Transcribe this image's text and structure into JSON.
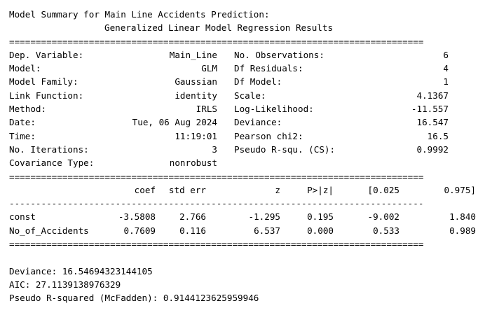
{
  "header": {
    "line1": "Model Summary for Main Line Accidents Prediction:",
    "line2": "Generalized Linear Model Regression Results"
  },
  "rules": {
    "double": "==============================================================================",
    "single": "------------------------------------------------------------------------------"
  },
  "info": [
    {
      "l_label": "Dep. Variable:",
      "l_value": "Main_Line",
      "r_label": "No. Observations:",
      "r_value": "6"
    },
    {
      "l_label": "Model:",
      "l_value": "GLM",
      "r_label": "Df Residuals:",
      "r_value": "4"
    },
    {
      "l_label": "Model Family:",
      "l_value": "Gaussian",
      "r_label": "Df Model:",
      "r_value": "1"
    },
    {
      "l_label": "Link Function:",
      "l_value": "identity",
      "r_label": "Scale:",
      "r_value": "4.1367"
    },
    {
      "l_label": "Method:",
      "l_value": "IRLS",
      "r_label": "Log-Likelihood:",
      "r_value": "-11.557"
    },
    {
      "l_label": "Date:",
      "l_value": "Tue, 06 Aug 2024",
      "r_label": "Deviance:",
      "r_value": "16.547"
    },
    {
      "l_label": "Time:",
      "l_value": "11:19:01",
      "r_label": "Pearson chi2:",
      "r_value": "16.5"
    },
    {
      "l_label": "No. Iterations:",
      "l_value": "3",
      "r_label": "Pseudo R-squ. (CS):",
      "r_value": "0.9992"
    },
    {
      "l_label": "Covariance Type:",
      "l_value": "nonrobust",
      "r_label": "",
      "r_value": ""
    }
  ],
  "coef_table": {
    "headers": [
      "",
      "coef",
      "std err",
      "z",
      "P>|z|",
      "[0.025",
      "0.975]"
    ],
    "rows": [
      [
        "const",
        "-3.5808",
        "2.766",
        "-1.295",
        "0.195",
        "-9.002",
        "1.840"
      ],
      [
        "No_of_Accidents",
        "0.7609",
        "0.116",
        "6.537",
        "0.000",
        "0.533",
        "0.989"
      ]
    ]
  },
  "footer": [
    "Deviance: 16.54694323144105",
    "AIC: 27.1139138976329",
    "Pseudo R-squared (McFadden): 0.9144123625959946"
  ]
}
